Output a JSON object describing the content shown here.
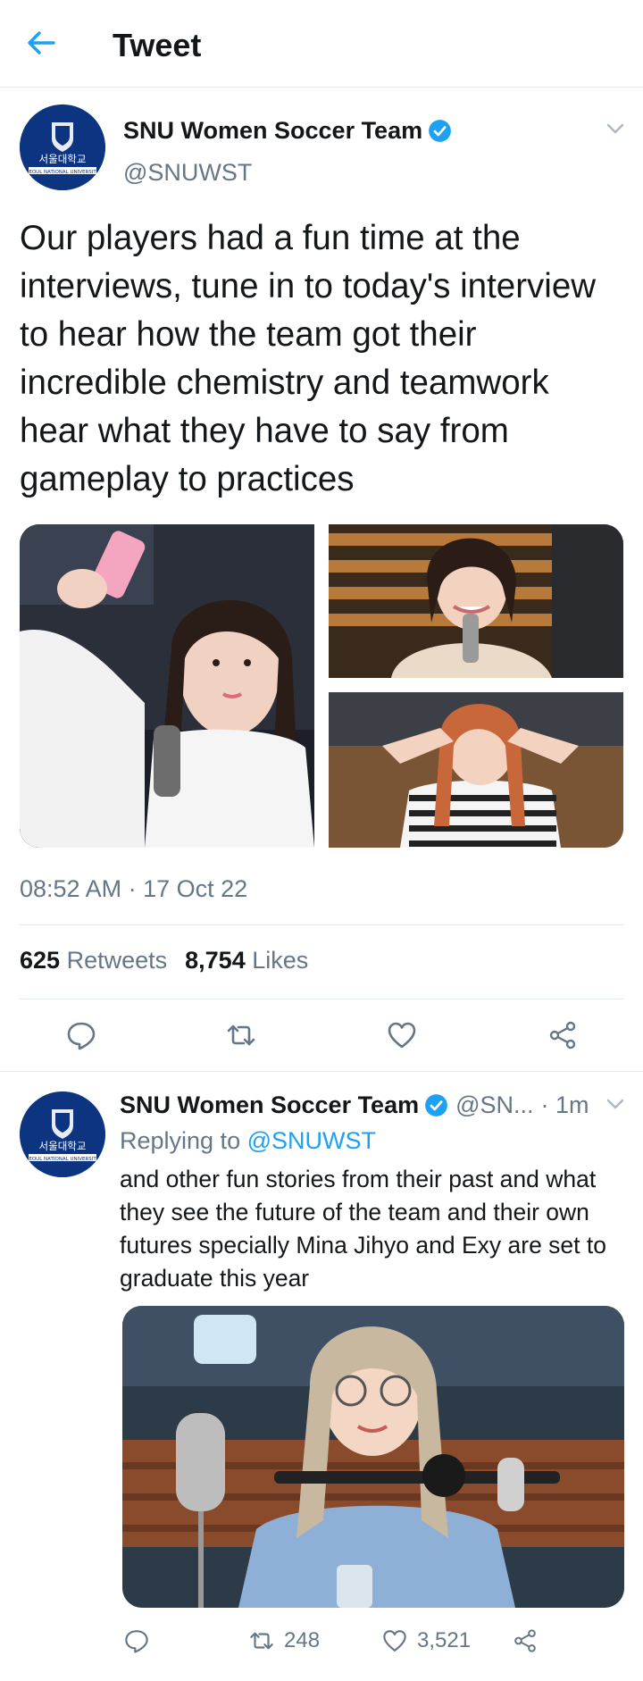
{
  "header": {
    "title": "Tweet",
    "back_icon": "arrow-left-icon"
  },
  "colors": {
    "accent": "#1da1f2",
    "secondary_text": "#657786",
    "primary_text": "#14171a",
    "divider": "#e1e8ed",
    "avatar_bg": "#0c3481"
  },
  "tweet": {
    "author": {
      "name": "SNU Women Soccer Team",
      "handle": "@SNUWST",
      "verified": true,
      "avatar_text": "서울대학교",
      "avatar_subtext": "SEOUL NATIONAL UNIVERSITY"
    },
    "text": "Our players had a fun time at the interviews, tune in to today's interview to hear how the team got their incredible chemistry and teamwork hear what they have to say from gameplay to practices",
    "timestamp": "08:52 AM · 17 Oct 22",
    "stats": {
      "retweets_count": "625",
      "retweets_label": "Retweets",
      "likes_count": "8,754",
      "likes_label": "Likes"
    },
    "actions": [
      "reply-icon",
      "retweet-icon",
      "like-icon",
      "share-icon"
    ]
  },
  "reply": {
    "author": {
      "name": "SNU Women Soccer Team",
      "handle": "@SN...",
      "time": "· 1m",
      "verified": true
    },
    "replying_to_label": "Replying to",
    "replying_to_handle": "@SNUWST",
    "text": "and other fun stories from their past and what they see the future of the team and their own futures specially Mina Jihyo and Exy are set to graduate this year",
    "stats": {
      "retweets": "248",
      "likes": "3,521"
    }
  }
}
